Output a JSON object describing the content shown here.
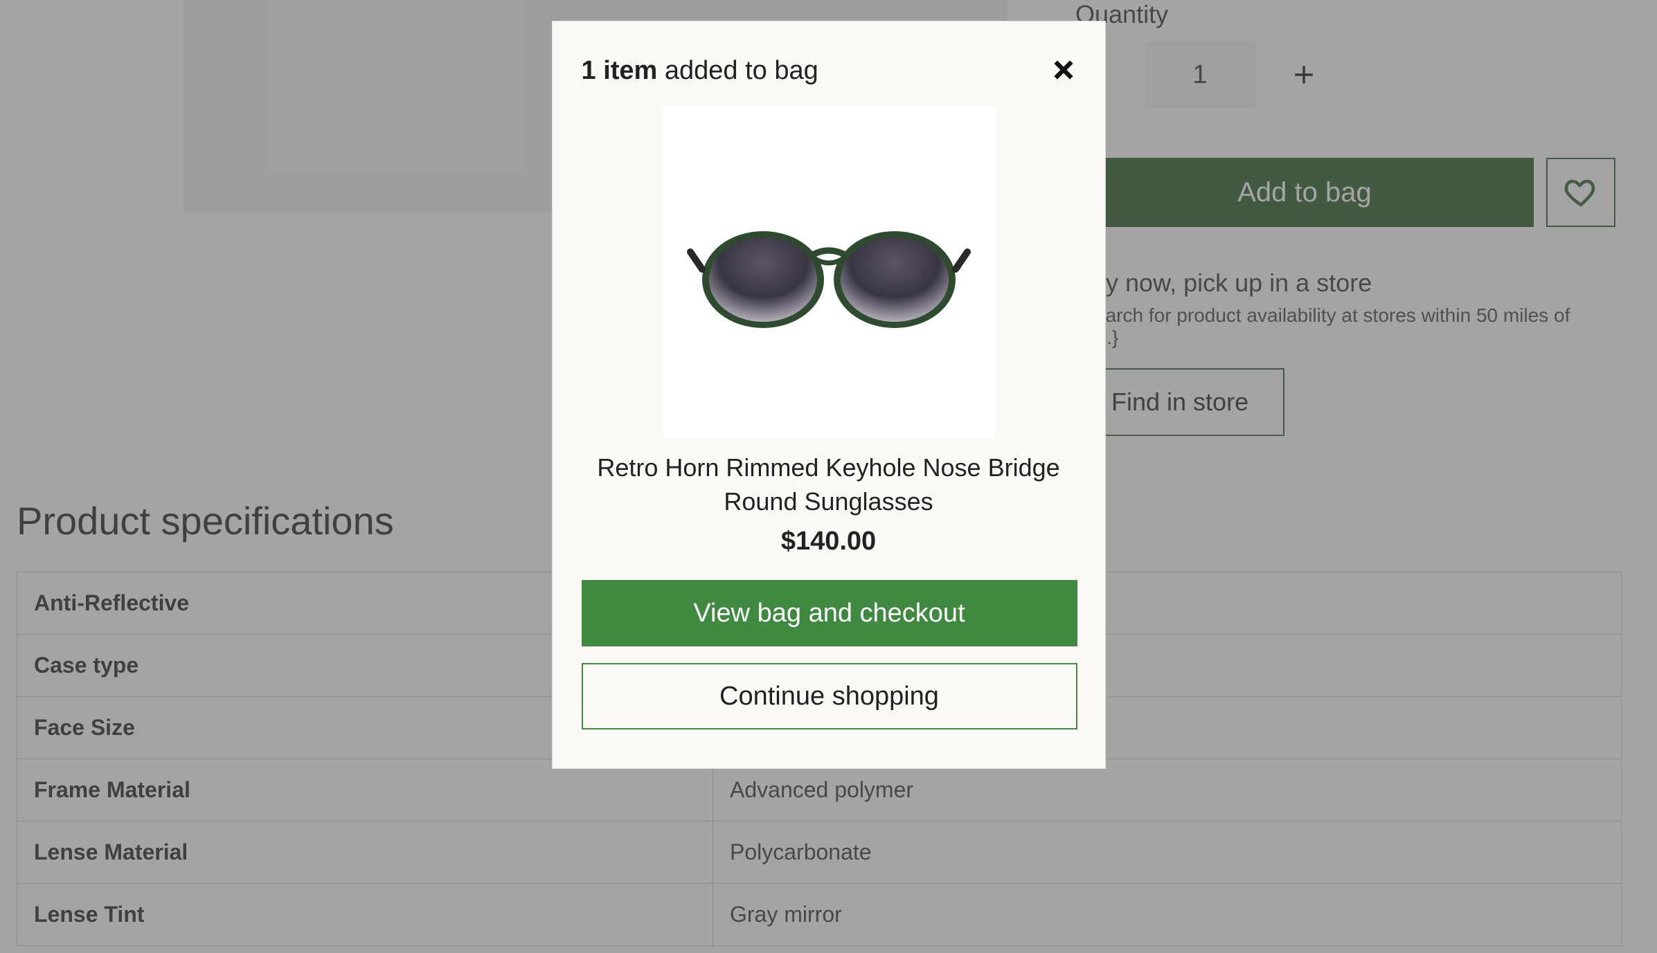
{
  "product": {
    "quantity_label": "Quantity",
    "quantity_value": "1",
    "add_to_bag_label": "Add to bag",
    "pickup_title": "Buy now, pick up in a store",
    "pickup_hint": "{Search for product availability at stores within 50 miles of you.}",
    "find_in_store_label": "Find in store"
  },
  "specs": {
    "heading": "Product specifications",
    "rows": [
      {
        "k": "Anti-Reflective",
        "v": ""
      },
      {
        "k": "Case type",
        "v": ""
      },
      {
        "k": "Face Size",
        "v": ""
      },
      {
        "k": "Frame Material",
        "v": "Advanced polymer"
      },
      {
        "k": "Lense Material",
        "v": "Polycarbonate"
      },
      {
        "k": "Lense Tint",
        "v": "Gray mirror"
      }
    ]
  },
  "modal": {
    "count_text": "1 item",
    "suffix_text": " added to bag",
    "product_name": "Retro Horn Rimmed Keyhole Nose Bridge Round Sunglasses",
    "price": "$140.00",
    "view_bag_label": "View bag and checkout",
    "continue_label": "Continue shopping"
  },
  "colors": {
    "brand_dark_green": "#265b27",
    "brand_green": "#3f8a40"
  }
}
